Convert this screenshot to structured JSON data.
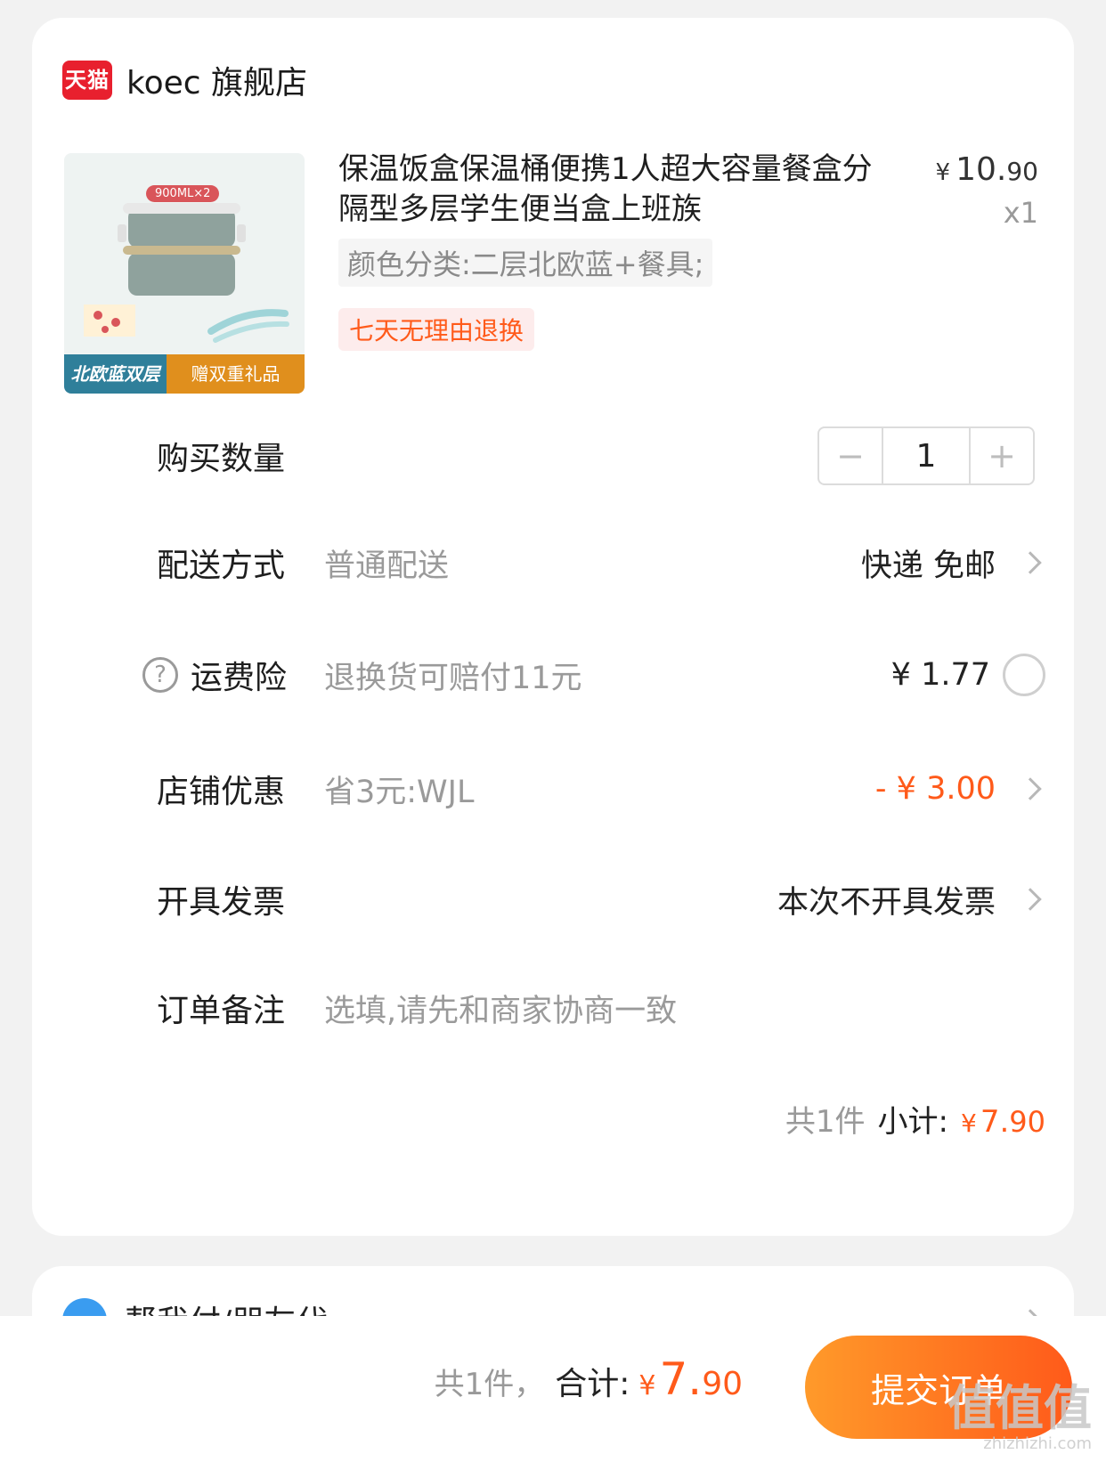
{
  "shop": {
    "logo_text": "天猫",
    "name": "koec 旗舰店"
  },
  "product": {
    "image": {
      "pill": "900ML×2",
      "band_left": "北欧蓝双层",
      "band_right": "赠双重礼品"
    },
    "title": "保温饭盒保温桶便携1人超大容量餐盒分隔型多层学生便当盒上班族",
    "price_currency": "¥",
    "price_main": "10.",
    "price_cents": "90",
    "qty": "x1",
    "spec": "颜色分类:二层北欧蓝+餐具;",
    "service_tag": "七天无理由退换"
  },
  "quantity": {
    "label": "购买数量",
    "minus": "−",
    "value": "1",
    "plus": "+"
  },
  "delivery": {
    "label": "配送方式",
    "value": "普通配送",
    "right": "快递 免邮"
  },
  "insurance": {
    "help": "?",
    "label": "运费险",
    "value": "退换货可赔付11元",
    "price": "¥ 1.77"
  },
  "store_discount": {
    "label": "店铺优惠",
    "value": "省3元:WJL",
    "amount": "- ¥ 3.00"
  },
  "invoice": {
    "label": "开具发票",
    "right": "本次不开具发票"
  },
  "remark": {
    "label": "订单备注",
    "placeholder": "选填,请先和商家协商一致"
  },
  "subtotal": {
    "count": "共1件",
    "label": "小计:",
    "currency": "¥",
    "main": "7.",
    "cents": "90"
  },
  "pay_for_me": {
    "label": "帮我付/朋友代"
  },
  "footer": {
    "count": "共1件，",
    "label": "合计:",
    "currency": "¥",
    "main": "7.",
    "cents": "90",
    "submit": "提交订单"
  },
  "watermark": {
    "main": "值值值",
    "sub": "zhizhizhi.com"
  },
  "colors": {
    "accent": "#ff5a1a",
    "tmall_red": "#e8202e",
    "muted_text": "#9a9a9a"
  },
  "icons": [
    "tmall-logo",
    "help-icon",
    "chevron-right-icon",
    "radio-icon",
    "pay-for-me-icon"
  ]
}
